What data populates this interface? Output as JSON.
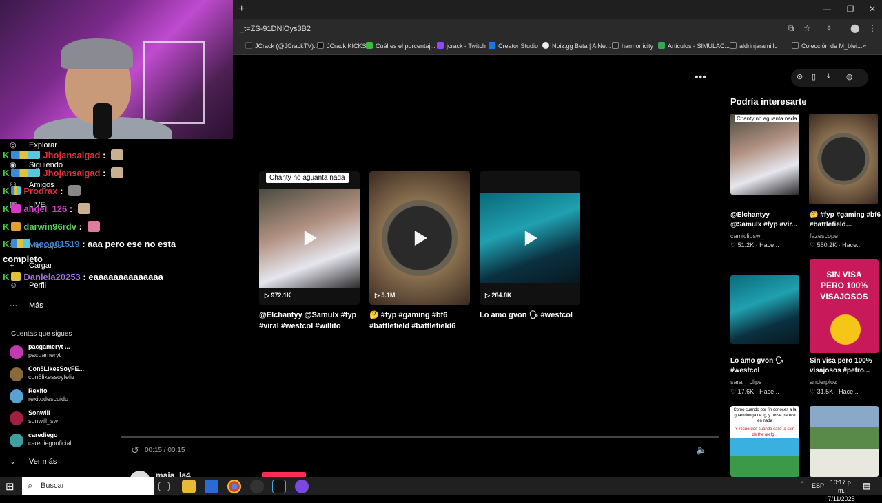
{
  "browser": {
    "url": "_t=ZS-91DNlOys3B2",
    "bookmarks": [
      "JCrack (@JCrackTV)...",
      "JCrack KICKS",
      "Cuál es el porcentaj...",
      "jcrack - Twitch",
      "Creator Studio",
      "Noiz.gg Beta | A Ne...",
      "harmonicity",
      "Articulos - SIMULAC...",
      "aldrinjaramillo",
      "Colección de M_blei..."
    ]
  },
  "nav": {
    "items": [
      "Explorar",
      "Siguiendo",
      "Amigos",
      "LIVE",
      "Mensajes",
      "Cargar",
      "Perfil",
      "Más"
    ],
    "following_title": "Cuentas que sigues",
    "accounts": [
      {
        "name": "pacgameryt ...",
        "handle": "pacgameryt"
      },
      {
        "name": "Con5LikesSoyFE...",
        "handle": "con5likessoyfeliz"
      },
      {
        "name": "Rexito",
        "handle": "rexitodescuido"
      },
      {
        "name": "Sonwill",
        "handle": "sonwill_sw"
      },
      {
        "name": "carediego",
        "handle": "carediegooficial"
      }
    ],
    "see_more": "Ver más"
  },
  "chat": [
    {
      "user": "Jhojansalgad",
      "color": "#e0303a",
      "msg": ""
    },
    {
      "user": "Jhojansalgad",
      "color": "#e0303a",
      "msg": ""
    },
    {
      "user": "Prodrax",
      "color": "#e0303a",
      "msg": ""
    },
    {
      "user": "angel_126",
      "color": "#d83ac8",
      "msg": ""
    },
    {
      "user": "darwin96rdv",
      "color": "#5ad05a",
      "msg": ""
    },
    {
      "user": "neoo01519",
      "color": "#3a8ae0",
      "msg": "aaa pero ese no esta"
    },
    {
      "user": "Daniela20253",
      "color": "#a070e0",
      "msg": "eaaaaaaaaaaaaaa"
    }
  ],
  "chat_wrap": "completo",
  "main": {
    "cards": [
      {
        "tag": "Chanty no aguanta nada",
        "views": "972.1K",
        "caption": "@Elchantyy @Samulx #fyp #viral #westcol #willito"
      },
      {
        "tag": "",
        "views": "5.1M",
        "caption": "🤔 #fyp #gaming #bf6 #battlefield #battlefield6"
      },
      {
        "tag": "",
        "views": "284.8K",
        "caption": "Lo amo gvon 🗣 #westcol"
      }
    ],
    "time": "00:15 / 00:15",
    "author": "maja_la4"
  },
  "sidebar": {
    "title": "Podría interesarte",
    "items": [
      {
        "tag": "Chanty no aguanta nada",
        "caption": "@Elchantyy @Samulx #fyp #vir...",
        "user": "camiclipsw_",
        "likes": "51.2K",
        "when": "Hace..."
      },
      {
        "tag": "",
        "caption": "🤔 #fyp #gaming #bf6 #battlefield...",
        "user": "fazescope",
        "likes": "550.2K",
        "when": "Hace..."
      },
      {
        "tag": "",
        "caption": "Lo amo gvon 🗣 #westcol",
        "user": "sara__clips",
        "likes": "17.6K",
        "when": "Hace..."
      },
      {
        "tag": "SIN VISA PERO 100% VISAJOSOS",
        "caption": "Sin visa pero 100% visajosos #petro...",
        "user": "anderploz",
        "likes": "31.5K",
        "when": "Hace..."
      }
    ],
    "thumb5_text": "Como cuando por fin conoces a la guamdonga de ig, y no se parece en nada",
    "thumb5_text2": "Y recuerdas cuando salió la skin de the grefg..."
  },
  "taskbar": {
    "search": "Buscar",
    "lang": "ESP",
    "time": "10:17 p. m.",
    "date": "7/11/2025"
  }
}
